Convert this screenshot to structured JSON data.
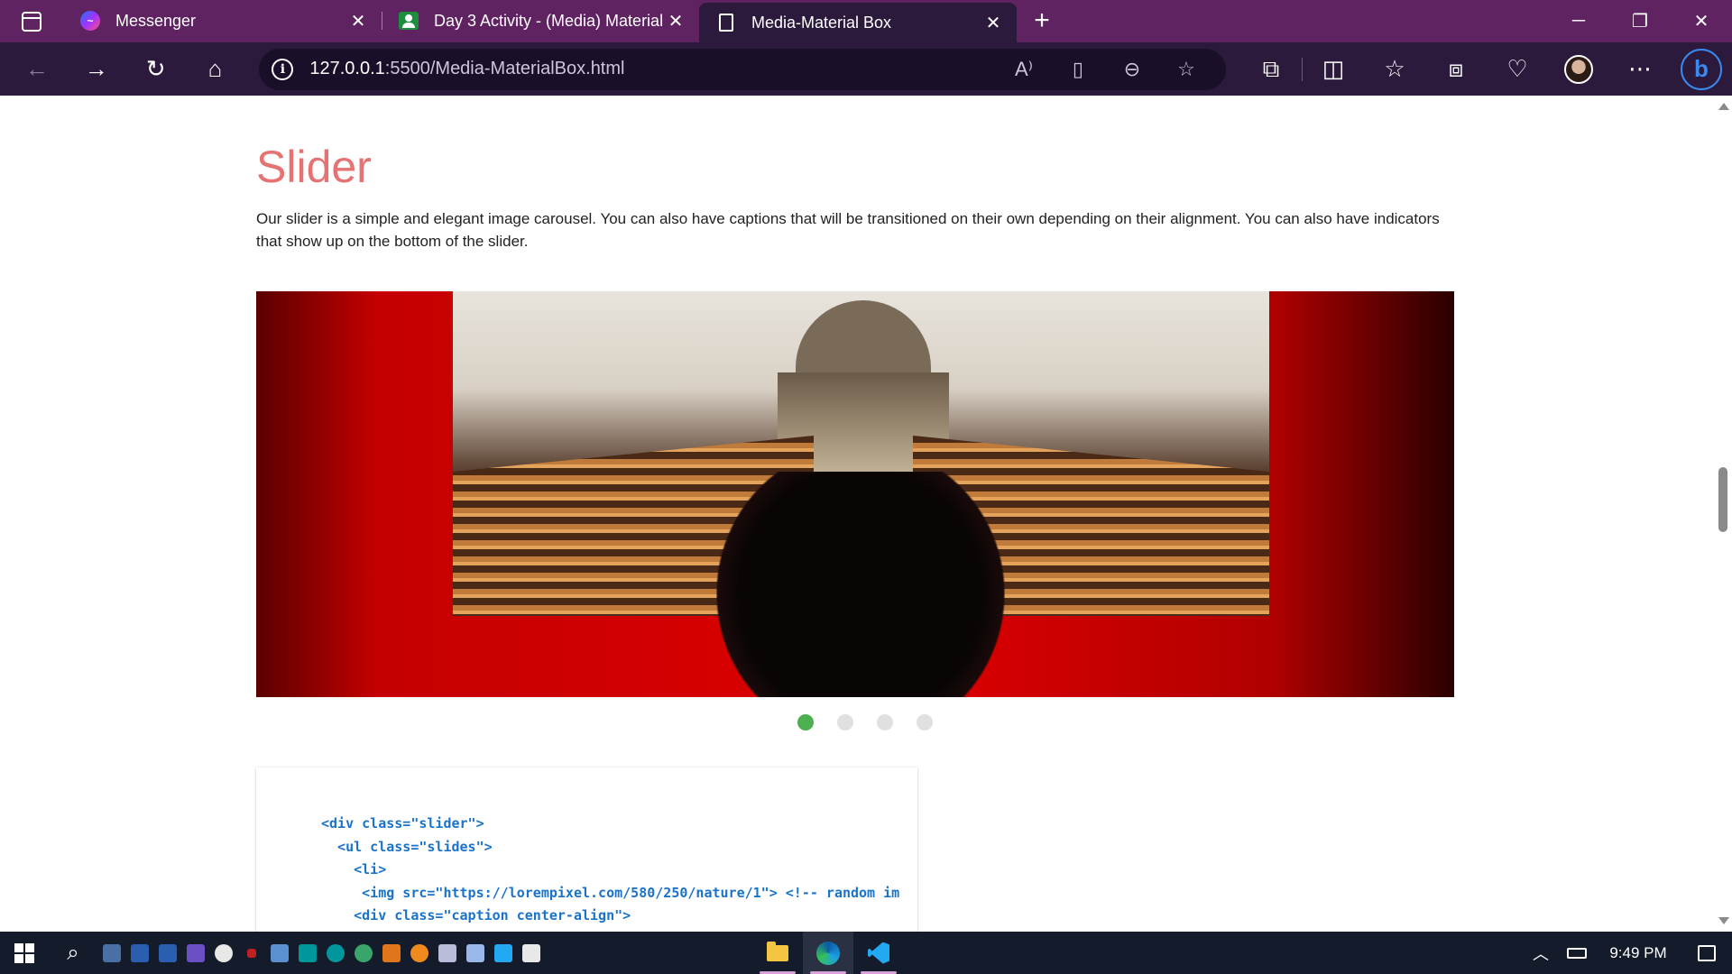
{
  "browser": {
    "tabs": [
      {
        "title": "Messenger",
        "icon": "messenger-icon",
        "active": false
      },
      {
        "title": "Day 3 Activity - (Media) Material",
        "icon": "google-classroom-icon",
        "active": false
      },
      {
        "title": "Media-Material Box",
        "icon": "document-icon",
        "active": true
      }
    ],
    "url_host": "127.0.0.1",
    "url_path": ":5500/Media-MaterialBox.html"
  },
  "page": {
    "heading": "Slider",
    "description": "Our slider is a simple and elegant image carousel. You can also have captions that will be transitioned on their own depending on their alignment. You can also have indicators that show up on the bottom of the slider.",
    "slider": {
      "image_alt": "Church interior with wooden pews, person in foreground, red background",
      "indicators": 4,
      "active_indicator": 1,
      "indicator_active_color": "#4caf50"
    },
    "code_lines": [
      "<div class=\"slider\">",
      "  <ul class=\"slides\">",
      "    <li>",
      "     <img src=\"https://lorempixel.com/580/250/nature/1\"> <!-- random im",
      "    <div class=\"caption center-align\">"
    ]
  },
  "colors": {
    "heading": "#e57373",
    "code": "#1a73c9",
    "tabbar": "#5f2361",
    "toolbar": "#2b1a3c"
  },
  "taskbar": {
    "time": "9:49 PM"
  }
}
